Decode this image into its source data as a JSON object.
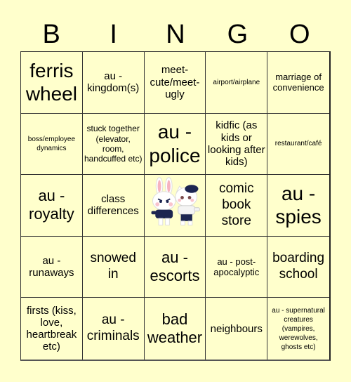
{
  "header": {
    "letters": [
      "B",
      "I",
      "N",
      "G",
      "O"
    ]
  },
  "colors": {
    "background": "#ffffcc",
    "grid_line": "#333333",
    "text": "#000000"
  },
  "cells": [
    {
      "text": "ferris wheel",
      "size": "xl"
    },
    {
      "text": "au - kingdom(s)",
      "size": "n"
    },
    {
      "text": "meet-cute/meet-ugly",
      "size": "n"
    },
    {
      "text": "airport/airplane",
      "size": "tiny"
    },
    {
      "text": "marriage of convenience",
      "size": "s"
    },
    {
      "text": "boss/employee dynamics",
      "size": "tiny"
    },
    {
      "text": "stuck together (elevator, room, handcuffed etc)",
      "size": "xs"
    },
    {
      "text": "au - police",
      "size": "xl"
    },
    {
      "text": "kidfic (as kids or looking after kids)",
      "size": "n"
    },
    {
      "text": "restaurant/café",
      "size": "tiny"
    },
    {
      "text": "au - royalty",
      "size": "l"
    },
    {
      "text": "class differences",
      "size": "n"
    },
    {
      "text": "",
      "size": "free",
      "icon": "bunny-and-cat-mascots-icon"
    },
    {
      "text": "comic book store",
      "size": "m"
    },
    {
      "text": "au - spies",
      "size": "xl"
    },
    {
      "text": "au - runaways",
      "size": "n"
    },
    {
      "text": "snowed in",
      "size": "m"
    },
    {
      "text": "au - escorts",
      "size": "l"
    },
    {
      "text": "au - post-apocalyptic",
      "size": "s"
    },
    {
      "text": "boarding school",
      "size": "m"
    },
    {
      "text": "firsts (kiss, love, heartbreak etc)",
      "size": "n"
    },
    {
      "text": "au - criminals",
      "size": "m"
    },
    {
      "text": "bad weather",
      "size": "l"
    },
    {
      "text": "neighbours",
      "size": "n"
    },
    {
      "text": "au - supernatural creatures (vampires, werewolves, ghosts etc)",
      "size": "tiny"
    }
  ]
}
